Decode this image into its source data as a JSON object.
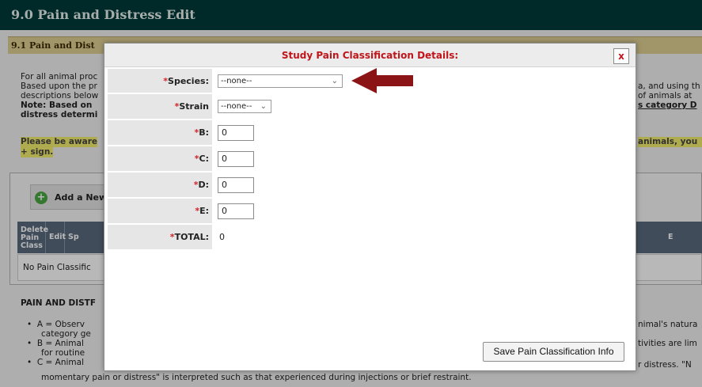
{
  "page": {
    "header_title": "9.0   Pain and Distress Edit",
    "section_title": "9.1  Pain and Dist",
    "intro_lines": [
      "For all animal proc",
      "Based upon the pr",
      "descriptions below"
    ],
    "note_line1": "Note:  Based on",
    "note_line2": "distress determi",
    "right_lines": [
      "a, and using th",
      "of animals at",
      "s category D"
    ],
    "warning_left_1": "Please be aware",
    "warning_left_2": "+ sign.",
    "warning_right": "animals, you",
    "add_button_label": "Add a New",
    "table_headers": [
      "Delete Pain Class",
      "Edit",
      "Sp",
      "E"
    ],
    "table_empty": "No Pain Classific",
    "pain_heading": "PAIN AND DISTF",
    "bullets": [
      "A = Observ",
      "category ge",
      "B = Animal",
      "for routine",
      "C = Animal",
      "momentary pain or distress\" is interpreted such as that experienced during injections or brief restraint."
    ],
    "bullets_right": [
      "nimal's natura",
      "tivities are lim",
      "r distress. \"N"
    ]
  },
  "modal": {
    "title": "Study Pain Classification Details:",
    "close_label": "x",
    "species_label": "Species:",
    "species_value": "--none--",
    "strain_label": "Strain",
    "strain_value": "--none--",
    "b_label": "B:",
    "b_value": "0",
    "c_label": "C:",
    "c_value": "0",
    "d_label": "D:",
    "d_value": "0",
    "e_label": "E:",
    "e_value": "0",
    "total_label": "TOTAL:",
    "total_value": "0",
    "required_mark": "*",
    "save_label": "Save Pain Classification Info",
    "chevron_icon": "chevron-down-icon"
  },
  "colors": {
    "header_bg": "#003b3a",
    "section_bg": "#e0cf94",
    "title_red": "#c0151a",
    "required_red": "#d0252b",
    "arrow_red": "#8b1516",
    "highlight_yellow": "#f3ee6e"
  }
}
